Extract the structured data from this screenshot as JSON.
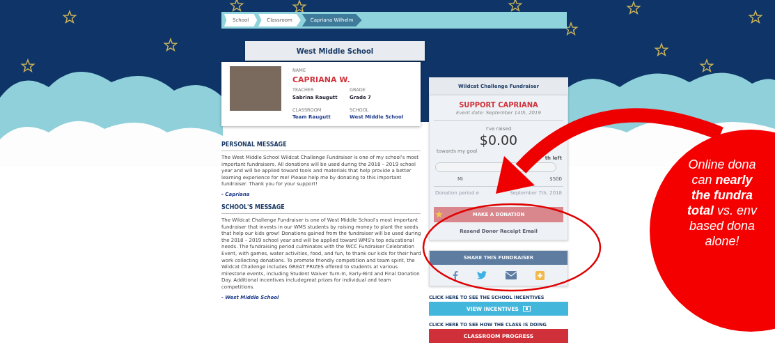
{
  "breadcrumb": [
    {
      "label": "School",
      "selected": false
    },
    {
      "label": "Classroom",
      "selected": false
    },
    {
      "label": "Capriana Wilhelm",
      "selected": true
    }
  ],
  "school_banner": "West Middle School",
  "student": {
    "name_label": "NAME",
    "name": "CAPRIANA W.",
    "fields": [
      {
        "label": "TEACHER",
        "value": "Sabrina Raugutt"
      },
      {
        "label": "GRADE",
        "value": "Grade 7"
      },
      {
        "label": "CLASSROOM",
        "value": "Team Raugutt"
      },
      {
        "label": "SCHOOL",
        "value": "West Middle School"
      }
    ]
  },
  "personal_message": {
    "heading": "PERSONAL MESSAGE",
    "text": "The West Middle School Wildcat Challenge Fundraiser is one of my school's most important fundraisers. All donations will be used during the 2018 – 2019 school year and will be applied toward tools and materials that help provide a better learning experience for me! Please help me by donating to this important fundraiser. Thank you for your support!",
    "signature": "- Capriana"
  },
  "school_message": {
    "heading": "SCHOOL'S MESSAGE",
    "text": "The Wildcat Challenge Fundraiser is one of West Middle School's most important fundraiser that invests in our WMS students by raising money to plant the seeds that help our kids grow! Donations gained from the fundraiser will be used during the 2018 – 2019 school year and will be applied toward WMS's top educational needs. The fundraising period culminates with the WCC Fundraiser Celebration Event, with games, water activities, food, and fun, to thank our kids for their hard work collecting donations. To promote friendly competition and team spirit, the Wildcat Challenge includes GREAT PRIZES offered to students at various milestone events, including Student Waiver Turn-In, Early-Bird and Final Donation Day. Additional incentives includegreat prizes for individual and team competitions.",
    "signature": "- West Middle School"
  },
  "fundraiser": {
    "ribbon": "Wildcat Challenge Fundraiser",
    "title": "SUPPORT CAPRIANA",
    "event_date": "Event date: September 14th, 2019",
    "raised_label": "I've raised",
    "raised": "$0.00",
    "goal_text": "towards my goal",
    "time_left": "th left",
    "progress": {
      "level": 0
    },
    "goal_min": "Mi",
    "goal_max": "$500",
    "period_start": "Donation period e",
    "period_end": "September 7th, 2018",
    "donate_button": "MAKE A DONATION",
    "resend_link": "Resend Donor Receipt Email"
  },
  "share": {
    "title": "SHARE THIS FUNDRAISER",
    "buttons": [
      {
        "kind": "facebook"
      },
      {
        "kind": "twitter"
      },
      {
        "kind": "email"
      },
      {
        "kind": "more"
      }
    ]
  },
  "incentives": {
    "hint": "CLICK HERE TO SEE THE SCHOOL INCENTIVES",
    "button": "VIEW INCENTIVES"
  },
  "class_progress": {
    "hint": "CLICK HERE TO SEE HOW THE CLASS IS DOING",
    "button": "CLASSROOM PROGRESS"
  },
  "callout": {
    "lines": [
      "Online dona",
      "can **nearly**",
      "**the fundra**",
      "**total** vs. env",
      "based dona",
      "alone!"
    ]
  }
}
